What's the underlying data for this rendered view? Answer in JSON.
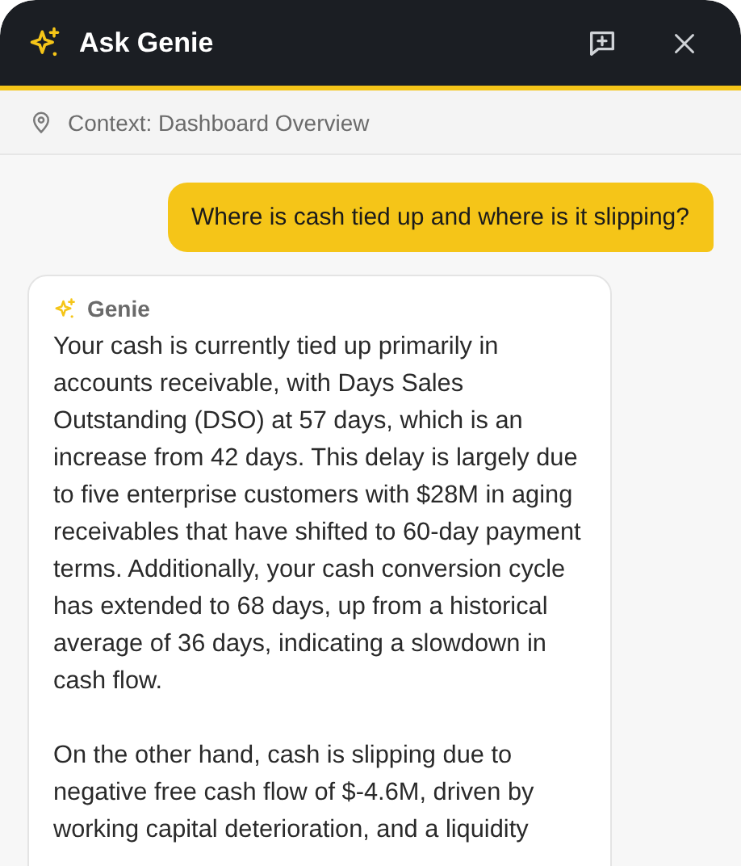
{
  "header": {
    "title": "Ask Genie"
  },
  "context": {
    "label": "Context: Dashboard Overview"
  },
  "messages": [
    {
      "kind": "user",
      "text": "Where is cash tied up and where is it slipping?"
    },
    {
      "kind": "assistant",
      "sender": "Genie",
      "paragraphs": [
        "Your cash is currently tied up primarily in accounts receivable, with Days Sales Outstanding (DSO) at 57 days, which is an increase from 42 days. This delay is largely due to five enterprise customers with $28M in aging receivables that have shifted to 60-day payment terms. Additionally, your cash conversion cycle has extended to 68 days, up from a historical average of 36 days, indicating a slowdown in cash flow.",
        "On the other hand, cash is slipping due to negative free cash flow of $-4.6M, driven by working capital deterioration, and a liquidity"
      ]
    }
  ]
}
